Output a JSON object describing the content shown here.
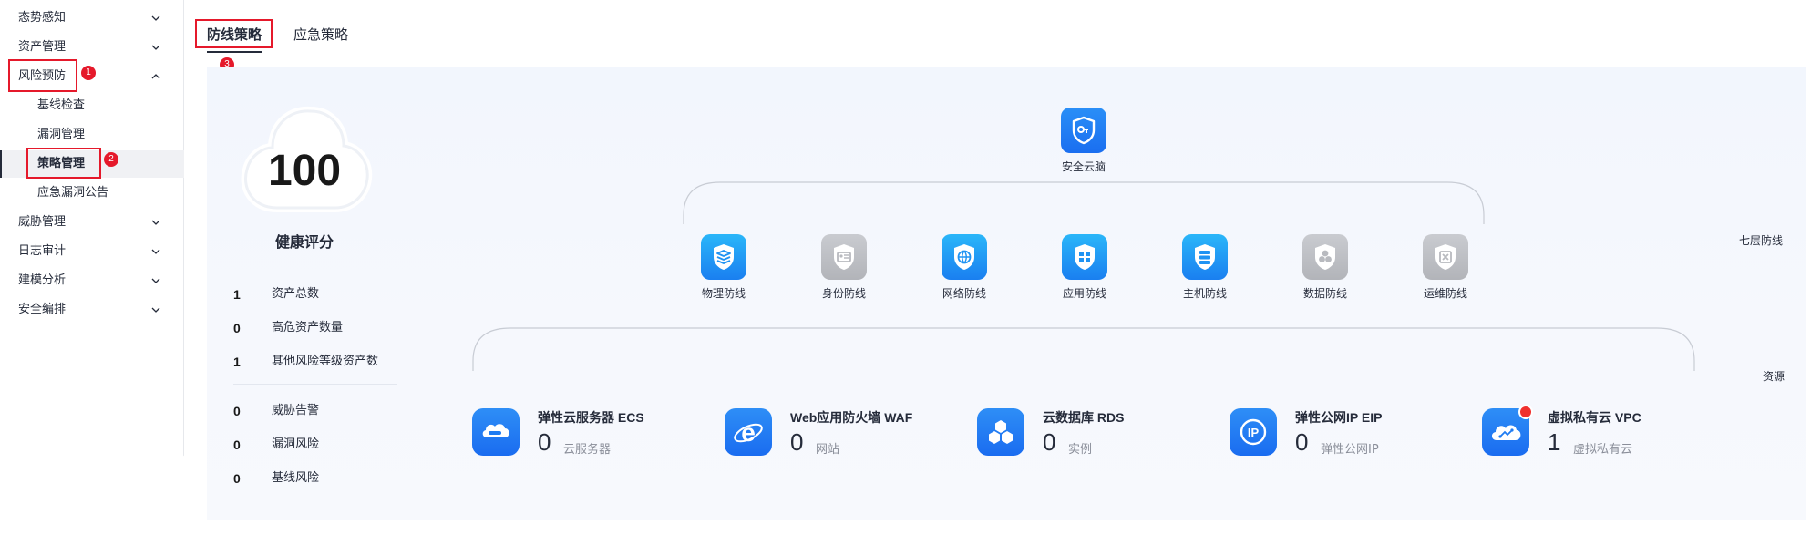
{
  "sidebar": {
    "items": [
      {
        "label": "态势感知",
        "expanded": false
      },
      {
        "label": "资产管理",
        "expanded": false
      },
      {
        "label": "风险预防",
        "expanded": true,
        "children": [
          "基线检查",
          "漏洞管理",
          "策略管理",
          "应急漏洞公告"
        ],
        "active_child": "策略管理"
      },
      {
        "label": "威胁管理",
        "expanded": false
      },
      {
        "label": "日志审计",
        "expanded": false
      },
      {
        "label": "建模分析",
        "expanded": false
      },
      {
        "label": "安全编排",
        "expanded": false
      }
    ],
    "collapse_icon": "chevron-left-icon"
  },
  "annotations": {
    "m1": "1",
    "m2": "2",
    "m3": "3"
  },
  "tabs": [
    {
      "label": "防线策略",
      "active": true
    },
    {
      "label": "应急策略",
      "active": false
    }
  ],
  "health": {
    "score": "100",
    "label": "健康评分",
    "stats_group1": [
      {
        "value": "1",
        "label": "资产总数"
      },
      {
        "value": "0",
        "label": "高危资产数量"
      },
      {
        "value": "1",
        "label": "其他风险等级资产数"
      }
    ],
    "stats_group2": [
      {
        "value": "0",
        "label": "威胁告警"
      },
      {
        "value": "0",
        "label": "漏洞风险"
      },
      {
        "value": "0",
        "label": "基线风险"
      }
    ]
  },
  "defense": {
    "root": {
      "label": "安全云脑",
      "icon": "security-brain-icon"
    },
    "layer_label": "七层防线",
    "resource_label": "资源",
    "lines": [
      {
        "label": "物理防线",
        "enabled": true,
        "icon": "layers-icon"
      },
      {
        "label": "身份防线",
        "enabled": false,
        "icon": "id-card-icon"
      },
      {
        "label": "网络防线",
        "enabled": true,
        "icon": "network-shield-icon"
      },
      {
        "label": "应用防线",
        "enabled": true,
        "icon": "app-grid-icon"
      },
      {
        "label": "主机防线",
        "enabled": true,
        "icon": "server-icon"
      },
      {
        "label": "数据防线",
        "enabled": false,
        "icon": "database-icon"
      },
      {
        "label": "运维防线",
        "enabled": false,
        "icon": "ops-shield-icon"
      }
    ]
  },
  "resources": [
    {
      "title": "弹性云服务器 ECS",
      "value": "0",
      "unit": "云服务器",
      "icon": "ecs-icon",
      "alert": false
    },
    {
      "title": "Web应用防火墙 WAF",
      "value": "0",
      "unit": "网站",
      "icon": "waf-icon",
      "alert": false
    },
    {
      "title": "云数据库 RDS",
      "value": "0",
      "unit": "实例",
      "icon": "rds-icon",
      "alert": false
    },
    {
      "title": "弹性公网IP EIP",
      "value": "0",
      "unit": "弹性公网IP",
      "icon": "eip-icon",
      "alert": false
    },
    {
      "title": "虚拟私有云 VPC",
      "value": "1",
      "unit": "虚拟私有云",
      "icon": "vpc-icon",
      "alert": true
    }
  ],
  "colors": {
    "accent": "#1a7ff0",
    "disabled": "#b2b4b9",
    "annotation": "#e5192b"
  }
}
